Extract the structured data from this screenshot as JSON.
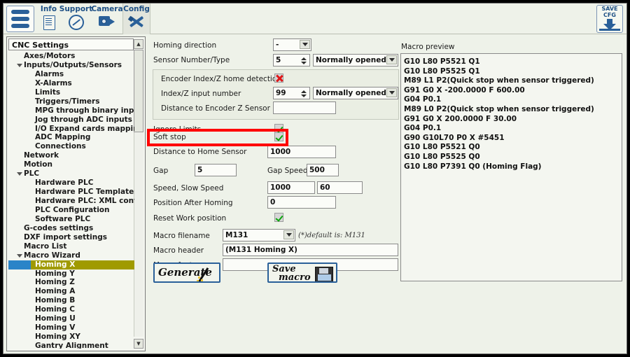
{
  "toolbar": {
    "menu_icon": "hamburger-icon",
    "tabs": [
      {
        "label": "Info",
        "icon": "document-icon",
        "active": false
      },
      {
        "label": "Support",
        "icon": "gauge-icon",
        "active": false
      },
      {
        "label": "Camera",
        "icon": "camera-icon",
        "active": false
      },
      {
        "label": "Config",
        "icon": "tools-icon",
        "active": true
      }
    ],
    "save_cfg_line1": "SAVE",
    "save_cfg_line2": "CFG",
    "save_cfg_icon": "download-arrow-icon"
  },
  "sidebar": {
    "header": "CNC Settings",
    "items": [
      {
        "label": "Axes/Motors",
        "level": 1,
        "expander": false,
        "selected": false
      },
      {
        "label": "Inputs/Outputs/Sensors",
        "level": 1,
        "expander": true,
        "selected": false
      },
      {
        "label": "Alarms",
        "level": 2,
        "expander": false,
        "selected": false
      },
      {
        "label": "X-Alarms",
        "level": 2,
        "expander": false,
        "selected": false
      },
      {
        "label": "Limits",
        "level": 2,
        "expander": false,
        "selected": false
      },
      {
        "label": "Triggers/Timers",
        "level": 2,
        "expander": false,
        "selected": false
      },
      {
        "label": "MPG through binary inputs",
        "level": 2,
        "expander": false,
        "selected": false
      },
      {
        "label": "Jog through ADC inputs",
        "level": 2,
        "expander": false,
        "selected": false
      },
      {
        "label": "I/O Expand cards mapping",
        "level": 2,
        "expander": false,
        "selected": false
      },
      {
        "label": "ADC Mapping",
        "level": 2,
        "expander": false,
        "selected": false
      },
      {
        "label": "Connections",
        "level": 2,
        "expander": false,
        "selected": false
      },
      {
        "label": "Network",
        "level": 1,
        "expander": false,
        "selected": false
      },
      {
        "label": "Motion",
        "level": 1,
        "expander": false,
        "selected": false
      },
      {
        "label": "PLC",
        "level": 1,
        "expander": true,
        "selected": false
      },
      {
        "label": "Hardware PLC",
        "level": 2,
        "expander": false,
        "selected": false
      },
      {
        "label": "Hardware PLC Templates",
        "level": 2,
        "expander": false,
        "selected": false
      },
      {
        "label": "Hardware PLC: XML configs",
        "level": 2,
        "expander": false,
        "selected": false
      },
      {
        "label": "PLC Configuration",
        "level": 2,
        "expander": false,
        "selected": false
      },
      {
        "label": "Software PLC",
        "level": 2,
        "expander": false,
        "selected": false
      },
      {
        "label": "G-codes settings",
        "level": 1,
        "expander": false,
        "selected": false
      },
      {
        "label": "DXF import settings",
        "level": 1,
        "expander": false,
        "selected": false
      },
      {
        "label": "Macro List",
        "level": 1,
        "expander": false,
        "selected": false
      },
      {
        "label": "Macro Wizard",
        "level": 1,
        "expander": true,
        "selected": false
      },
      {
        "label": "Homing X",
        "level": 2,
        "expander": false,
        "selected": true
      },
      {
        "label": "Homing Y",
        "level": 2,
        "expander": false,
        "selected": false
      },
      {
        "label": "Homing Z",
        "level": 2,
        "expander": false,
        "selected": false
      },
      {
        "label": "Homing A",
        "level": 2,
        "expander": false,
        "selected": false
      },
      {
        "label": "Homing B",
        "level": 2,
        "expander": false,
        "selected": false
      },
      {
        "label": "Homing C",
        "level": 2,
        "expander": false,
        "selected": false
      },
      {
        "label": "Homing U",
        "level": 2,
        "expander": false,
        "selected": false
      },
      {
        "label": "Homing V",
        "level": 2,
        "expander": false,
        "selected": false
      },
      {
        "label": "Homing XY",
        "level": 2,
        "expander": false,
        "selected": false
      },
      {
        "label": "Gantry Alignment",
        "level": 2,
        "expander": false,
        "selected": false
      }
    ]
  },
  "form": {
    "homing_direction_label": "Homing direction",
    "homing_direction_value": "-",
    "sensor_number_label": "Sensor Number/Type",
    "sensor_number_value": "5",
    "sensor_type_value": "Normally opened",
    "encoder_index_label": "Encoder Index/Z home detection",
    "encoder_index_checked": false,
    "index_input_label": "Index/Z input number",
    "index_input_value": "99",
    "index_type_value": "Normally opened",
    "distance_encoder_label": "Distance to Encoder Z Sensor",
    "distance_encoder_value": "",
    "ignore_limits_label": "Ignore Limits",
    "ignore_limits_checked": true,
    "soft_stop_label": "Soft stop",
    "soft_stop_checked": true,
    "distance_home_label": "Distance to Home Sensor",
    "distance_home_value": "1000",
    "gap_label": "Gap",
    "gap_value": "5",
    "gap_speed_label": "Gap Speed",
    "gap_speed_value": "500",
    "speed_label": "Speed, Slow Speed",
    "speed_value": "1000",
    "slow_speed_value": "60",
    "position_after_label": "Position After Homing",
    "position_after_value": "0",
    "reset_work_label": "Reset Work position",
    "reset_work_checked": true,
    "macro_filename_label": "Macro filename",
    "macro_filename_value": "M131",
    "macro_filename_note": "(*)default is: M131",
    "macro_header_label": "Macro header",
    "macro_header_value": "(M131 Homing X)",
    "macro_footer_label": "Macro footer",
    "macro_footer_value": "",
    "generate_button": "Generate",
    "save_macro_line1": "Save",
    "save_macro_line2": "macro",
    "highlight_color": "#ff0000"
  },
  "preview": {
    "title": "Macro preview",
    "lines": [
      "G10 L80 P5521 Q1",
      "G10 L80 P5525 Q1",
      "M89 L1 P2(Quick stop when sensor triggered)",
      "G91 G0 X  -200.0000 F   600.00",
      "G04 P0.1",
      "M89 L0 P2(Quick stop when sensor triggered)",
      "G91 G0 X   200.0000 F    30.00",
      "G04 P0.1",
      "G90 G10L70 P0 X #5451",
      "G10 L80 P5521 Q0",
      "G10 L80 P5525 Q0",
      "G10 L80 P7391 Q0 (Homing Flag)"
    ]
  }
}
